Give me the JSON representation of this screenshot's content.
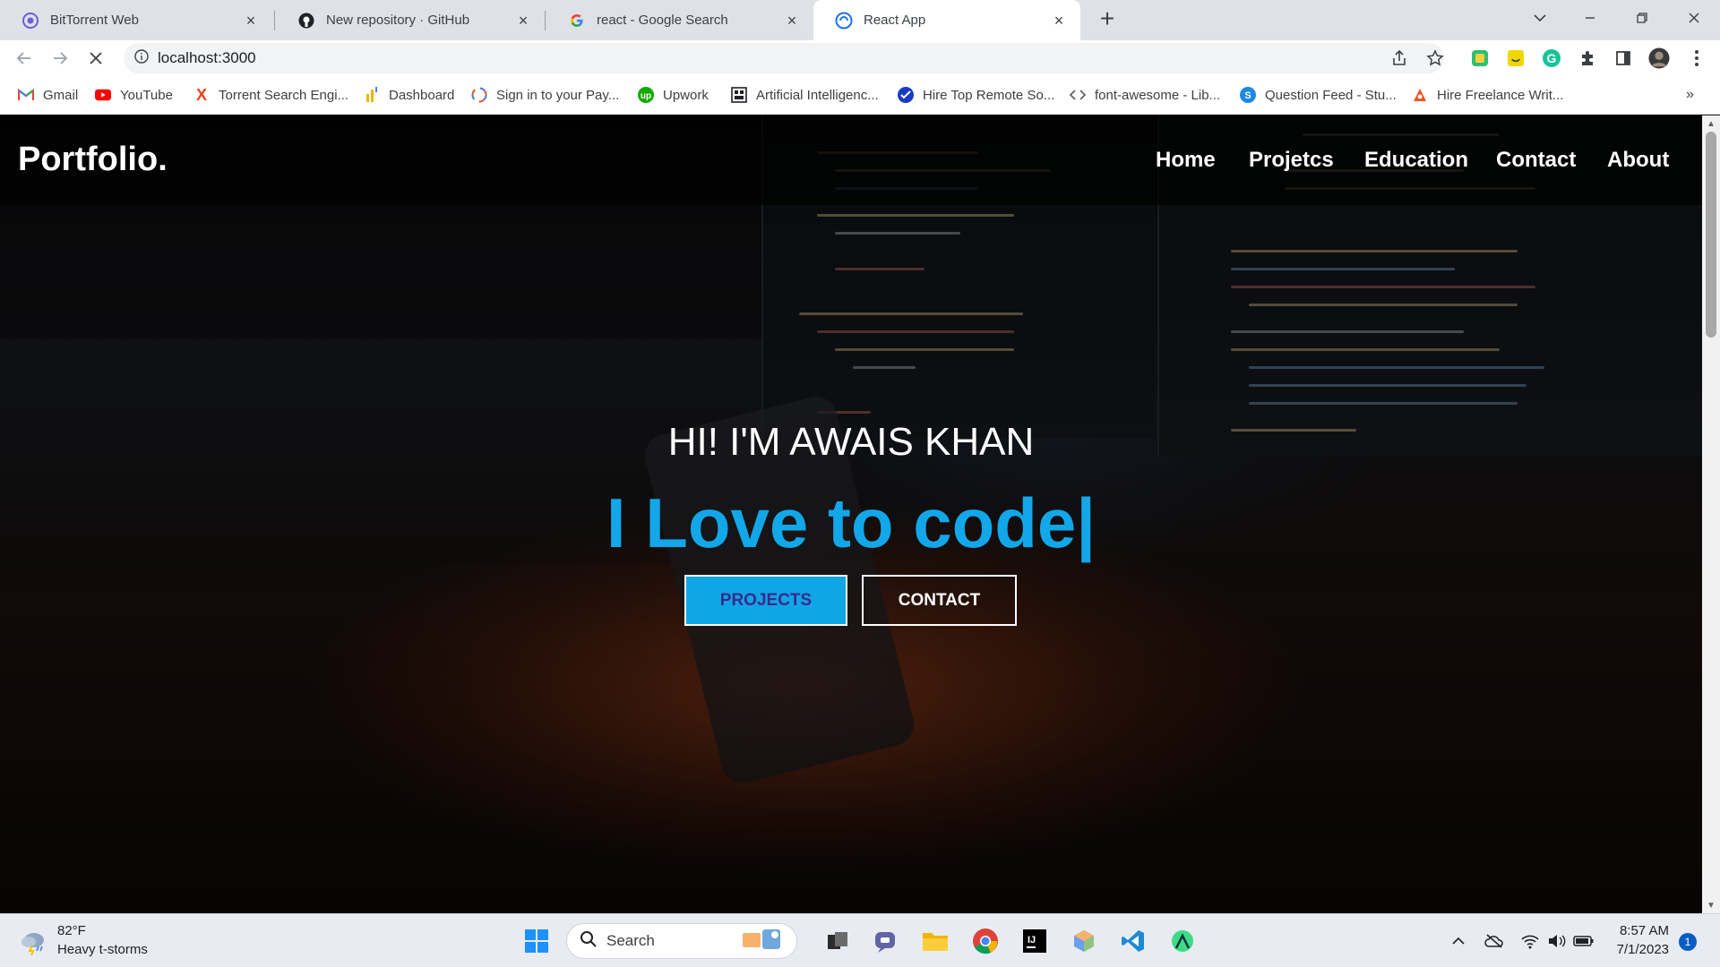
{
  "browser": {
    "tabs": [
      {
        "title": "BitTorrent Web",
        "icon": "bittorrent-icon",
        "active": false
      },
      {
        "title": "New repository · GitHub",
        "icon": "github-icon",
        "active": false
      },
      {
        "title": "react - Google Search",
        "icon": "google-icon",
        "active": false
      },
      {
        "title": "React App",
        "icon": "react-icon",
        "active": true
      }
    ],
    "close_glyph": "×",
    "new_tab_glyph": "+",
    "url": "localhost:3000",
    "bookmarks": [
      {
        "label": "Gmail",
        "icon": "gmail-icon"
      },
      {
        "label": "YouTube",
        "icon": "youtube-icon"
      },
      {
        "label": "Torrent Search Engi...",
        "icon": "torrent-icon"
      },
      {
        "label": "Dashboard",
        "icon": "dashboard-icon"
      },
      {
        "label": "Sign in to your Pay...",
        "icon": "payoneer-icon"
      },
      {
        "label": "Upwork",
        "icon": "upwork-icon"
      },
      {
        "label": "Artificial Intelligenc...",
        "icon": "ai-icon"
      },
      {
        "label": "Hire Top Remote So...",
        "icon": "hire-icon"
      },
      {
        "label": "font-awesome - Lib...",
        "icon": "code-icon"
      },
      {
        "label": "Question Feed - Stu...",
        "icon": "question-feed-icon"
      },
      {
        "label": "Hire Freelance Writ...",
        "icon": "freelance-icon"
      }
    ],
    "bookmarks_overflow": "»"
  },
  "site": {
    "brand": "Portfolio.",
    "nav": [
      "Home",
      "Projetcs",
      "Education",
      "Contact",
      "About"
    ],
    "hero": {
      "greeting": "HI! I'M AWAIS KHAN",
      "typed": "I Love to code|",
      "buttons": {
        "projects": "PROJECTS",
        "contact": "CONTACT"
      }
    }
  },
  "taskbar": {
    "weather": {
      "temp": "82°F",
      "desc": "Heavy t-storms"
    },
    "search_label": "Search",
    "clock": {
      "time": "8:57 AM",
      "date": "7/1/2023"
    },
    "notifications": "1"
  },
  "colors": {
    "accent": "#12a7e8",
    "projects_button_bg": "#0fa6e6",
    "projects_button_text": "#3a2a8c"
  }
}
